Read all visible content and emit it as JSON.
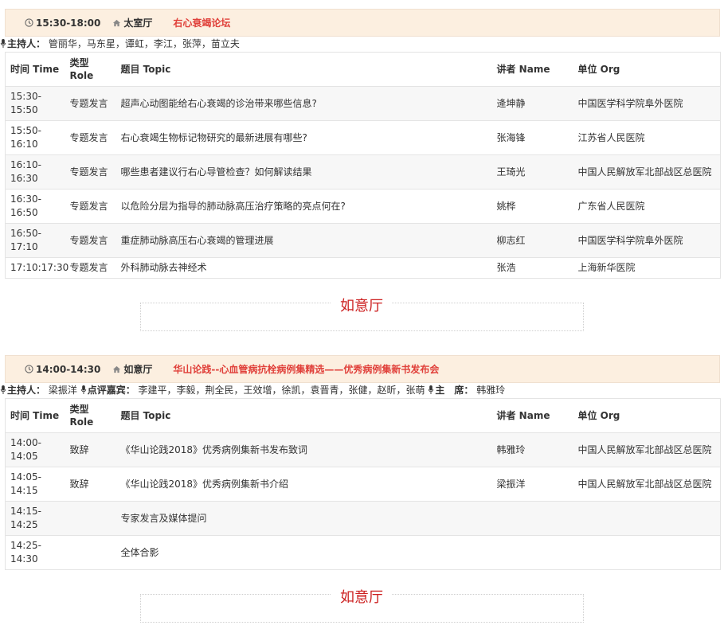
{
  "session1": {
    "time": "15:30-18:00",
    "hall": "太室厅",
    "title": "右心衰竭论坛",
    "hosts_label": "主持人：",
    "hosts": "管丽华，马东星，谭虹，李江，张萍，苗立夫",
    "headers": {
      "time": "时间 Time",
      "role": "类型 Role",
      "topic": "题目 Topic",
      "speaker": "讲者 Name",
      "org": "单位 Org"
    },
    "rows": [
      {
        "time": "15:30-15:50",
        "role": "专题发言",
        "topic": "超声心动图能给右心衰竭的诊治带来哪些信息?",
        "speaker": "逄坤静",
        "org": "中国医学科学院阜外医院"
      },
      {
        "time": "15:50-16:10",
        "role": "专题发言",
        "topic": "右心衰竭生物标记物研究的最新进展有哪些?",
        "speaker": "张海锋",
        "org": "江苏省人民医院"
      },
      {
        "time": "16:10-16:30",
        "role": "专题发言",
        "topic": "哪些患者建议行右心导管检查？如何解读结果",
        "speaker": "王琦光",
        "org": "中国人民解放军北部战区总医院"
      },
      {
        "time": "16:30-16:50",
        "role": "专题发言",
        "topic": "以危险分层为指导的肺动脉高压治疗策略的亮点何在?",
        "speaker": "姚桦",
        "org": "广东省人民医院"
      },
      {
        "time": "16:50-17:10",
        "role": "专题发言",
        "topic": "重症肺动脉高压右心衰竭的管理进展",
        "speaker": "柳志红",
        "org": "中国医学科学院阜外医院"
      },
      {
        "time": "17:10:17:30",
        "role": "专题发言",
        "topic": "外科肺动脉去神经术",
        "speaker": "张浩",
        "org": "上海新华医院"
      }
    ]
  },
  "hall_divider_1": "如意厅",
  "session2": {
    "time": "14:00-14:30",
    "hall": "如意厅",
    "title": "华山论践--心血管病抗栓病例集精选——优秀病例集新书发布会",
    "hosts_label": "主持人：",
    "hosts": "梁振洋",
    "reviewers_label": "点评嘉宾：",
    "reviewers": "李建平，李毅，荆全民，王效增，徐凯，袁晋青，张健，赵昕，张萌",
    "chair_label": "主　席：",
    "chair": "韩雅玲",
    "headers": {
      "time": "时间 Time",
      "role": "类型 Role",
      "topic": "题目 Topic",
      "speaker": "讲者 Name",
      "org": "单位 Org"
    },
    "rows": [
      {
        "time": "14:00-14:05",
        "role": "致辞",
        "topic": "《华山论践2018》优秀病例集新书发布致词",
        "speaker": "韩雅玲",
        "org": "中国人民解放军北部战区总医院"
      },
      {
        "time": "14:05-14:15",
        "role": "致辞",
        "topic": "《华山论践2018》优秀病例集新书介绍",
        "speaker": "梁振洋",
        "org": "中国人民解放军北部战区总医院"
      },
      {
        "time": "14:15-14:25",
        "role": "",
        "topic": "专家发言及媒体提问",
        "speaker": "",
        "org": ""
      },
      {
        "time": "14:25-14:30",
        "role": "",
        "topic": "全体合影",
        "speaker": "",
        "org": ""
      }
    ]
  },
  "hall_divider_2": "如意厅",
  "colors": {
    "header_bg": "#fcefe0",
    "title_red": "#e0403a",
    "hall_red": "#cc1f1f",
    "row_alt": "#f7f7f7"
  },
  "icons": {
    "time": "clock-icon",
    "hall": "home-icon",
    "host": "microphone-icon"
  }
}
